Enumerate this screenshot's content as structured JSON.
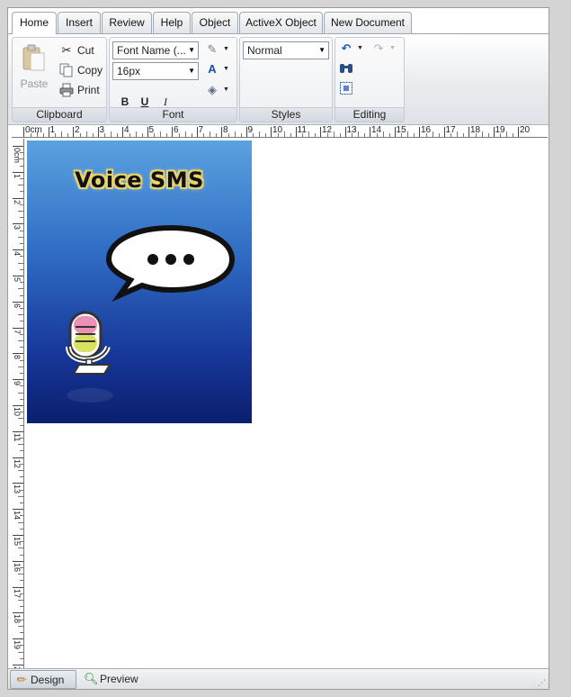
{
  "tabs": [
    "Home",
    "Insert",
    "Review",
    "Help",
    "Object",
    "ActiveX Object",
    "New Document"
  ],
  "clipboard": {
    "paste_label": "Paste",
    "cut_label": "Cut",
    "copy_label": "Copy",
    "print_label": "Print",
    "group_label": "Clipboard"
  },
  "font": {
    "font_name": "Font Name (...",
    "font_size": "16px",
    "bold_label": "B",
    "underline_label": "U",
    "italic_label": "I",
    "group_label": "Font"
  },
  "styles": {
    "selected": "Normal",
    "group_label": "Styles"
  },
  "editing": {
    "group_label": "Editing"
  },
  "ruler": {
    "h_labels": [
      "0cm",
      "1",
      "2",
      "3",
      "4",
      "5",
      "6",
      "7",
      "8",
      "9",
      "10",
      "11",
      "12",
      "13",
      "14",
      "15",
      "16",
      "17",
      "18",
      "19",
      "20"
    ],
    "v_labels": [
      "0cm",
      "1",
      "2",
      "3",
      "4",
      "5",
      "6",
      "7",
      "8",
      "9",
      "10",
      "11",
      "12",
      "13",
      "14",
      "15",
      "16",
      "17",
      "18",
      "19",
      "20"
    ]
  },
  "document": {
    "image_title": "Voice SMS"
  },
  "statusbar": {
    "design_label": "Design",
    "preview_label": "Preview"
  },
  "icons": {
    "paste": "paste-icon",
    "cut": "scissors-icon",
    "copy": "copy-icon",
    "print": "printer-icon",
    "highlight": "highlighter-icon",
    "font_color": "font-color-icon",
    "fill": "paint-bucket-icon",
    "undo": "undo-icon",
    "redo": "redo-icon",
    "find": "binoculars-icon",
    "select_all": "select-all-icon",
    "design": "pencil-icon",
    "preview": "magnifier-icon"
  },
  "colors": {
    "accent": "#2f6cc4",
    "poster_top": "#5aa2e0",
    "poster_bottom": "#0b1f6e"
  }
}
